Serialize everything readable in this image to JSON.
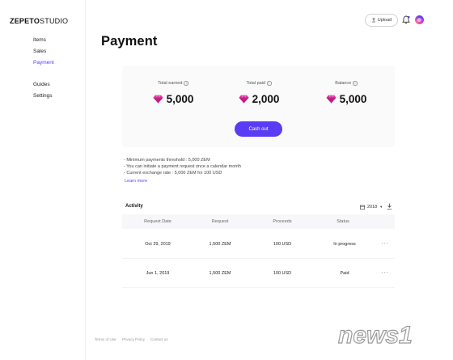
{
  "app": {
    "logo_bold": "ZEPETO",
    "logo_light": "STUDIO"
  },
  "sidebar": {
    "items": [
      {
        "label": "Items"
      },
      {
        "label": "Sales"
      },
      {
        "label": "Payment"
      },
      {
        "label": "Guides"
      },
      {
        "label": "Settings"
      }
    ]
  },
  "header": {
    "upload_label": "Upload"
  },
  "page": {
    "title": "Payment"
  },
  "summary": {
    "stats": [
      {
        "label": "Total earned",
        "value": "5,000"
      },
      {
        "label": "Total paid",
        "value": "2,000"
      },
      {
        "label": "Balance",
        "value": "5,000"
      }
    ],
    "cashout_label": "Cash out"
  },
  "notes": {
    "lines": [
      "- Minimum payments threshold : 5,000 ZEM",
      "- You can initiate a payment request once a calendar month",
      "- Current exchange rate : 5,000 ZEM for 100 USD"
    ],
    "learn_more": "Learn more"
  },
  "activity": {
    "title": "Activity",
    "year": "2018",
    "columns": [
      "Request Date",
      "Request",
      "Proceeds",
      "Status"
    ],
    "rows": [
      {
        "date": "Oct 29, 2019",
        "request": "1,500 ZEM",
        "proceeds": "100 USD",
        "status": "In progress"
      },
      {
        "date": "Jun 1, 2019",
        "request": "1,500 ZEM",
        "proceeds": "100 USD",
        "status": "Paid"
      }
    ],
    "more_label": "···"
  },
  "footer": {
    "links": [
      "Terms of Use",
      "Privacy Policy",
      "Contact us"
    ]
  },
  "watermark": {
    "text": "news1"
  },
  "colors": {
    "accent": "#5b3cf5",
    "gem": "#e0339e"
  },
  "icons": [
    "upload-icon",
    "bell-icon",
    "avatar",
    "info-icon",
    "gem-icon",
    "calendar-icon",
    "chevron-down-icon",
    "download-icon",
    "more-icon"
  ]
}
